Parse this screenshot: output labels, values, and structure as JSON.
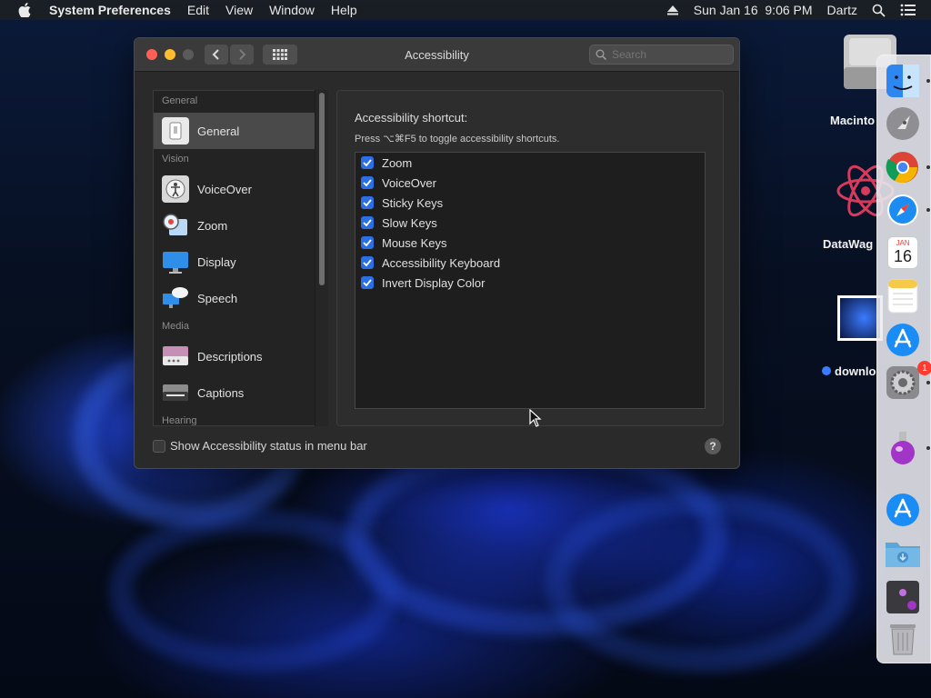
{
  "menubar": {
    "app_name": "System Preferences",
    "menus": [
      "Edit",
      "View",
      "Window",
      "Help"
    ],
    "datetime": "Sun Jan 16  9:06 PM",
    "user": "Dartz"
  },
  "window": {
    "title": "Accessibility",
    "search_placeholder": "Search"
  },
  "sidebar": {
    "sections": [
      {
        "header": "General",
        "items": [
          {
            "label": "General",
            "icon": "general-icon",
            "selected": true
          }
        ]
      },
      {
        "header": "Vision",
        "items": [
          {
            "label": "VoiceOver",
            "icon": "voiceover-icon"
          },
          {
            "label": "Zoom",
            "icon": "zoom-icon"
          },
          {
            "label": "Display",
            "icon": "display-icon"
          },
          {
            "label": "Speech",
            "icon": "speech-icon"
          }
        ]
      },
      {
        "header": "Media",
        "items": [
          {
            "label": "Descriptions",
            "icon": "descriptions-icon"
          },
          {
            "label": "Captions",
            "icon": "captions-icon"
          }
        ]
      },
      {
        "header": "Hearing",
        "items": []
      }
    ]
  },
  "pane": {
    "title": "Accessibility shortcut:",
    "subtitle": "Press ⌥⌘F5 to toggle accessibility shortcuts.",
    "shortcuts": [
      {
        "label": "Zoom",
        "checked": true
      },
      {
        "label": "VoiceOver",
        "checked": true
      },
      {
        "label": "Sticky Keys",
        "checked": true
      },
      {
        "label": "Slow Keys",
        "checked": true
      },
      {
        "label": "Mouse Keys",
        "checked": true
      },
      {
        "label": "Accessibility Keyboard",
        "checked": true
      },
      {
        "label": "Invert Display Color",
        "checked": true
      }
    ]
  },
  "footer": {
    "status_label": "Show Accessibility status in menu bar",
    "status_checked": false,
    "help_label": "?"
  },
  "desktop": {
    "items": [
      "Macinto",
      "DataWag",
      "downlo"
    ]
  },
  "dock": {
    "calendar_month": "JAN",
    "calendar_day": "16",
    "badge_count": "1"
  },
  "colors": {
    "accent": "#2b6fe6",
    "close": "#ff5f57",
    "minimize": "#febc2e"
  }
}
